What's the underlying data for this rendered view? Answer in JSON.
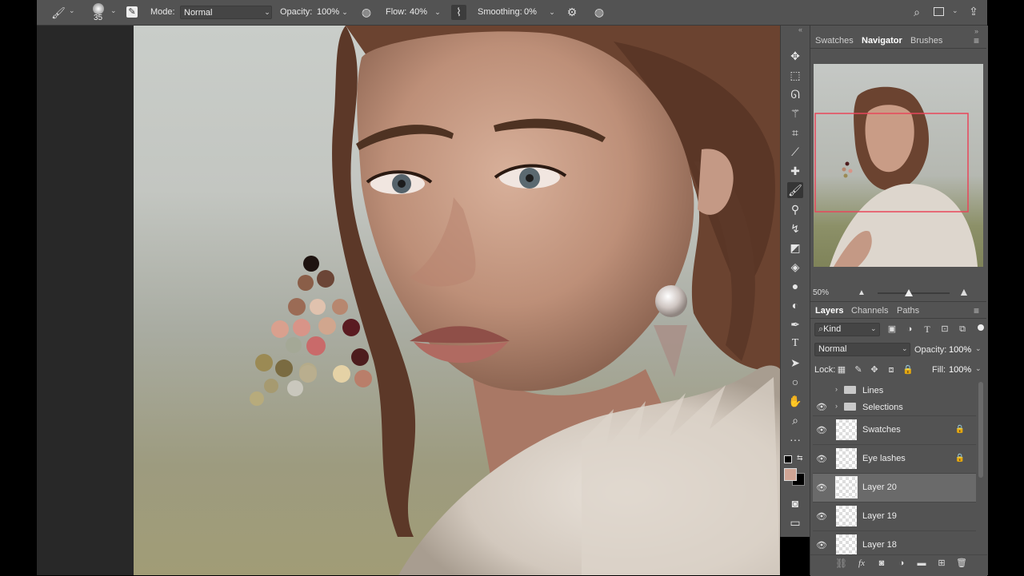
{
  "options_bar": {
    "brush_size": "35",
    "mode_label": "Mode:",
    "mode_value": "Normal",
    "opacity_label": "Opacity:",
    "opacity_value": "100%",
    "flow_label": "Flow:",
    "flow_value": "40%",
    "smoothing_label": "Smoothing:",
    "smoothing_value": "0%"
  },
  "navigator_panel": {
    "tabs": [
      "Swatches",
      "Navigator",
      "Brushes"
    ],
    "active_tab": "Navigator",
    "zoom": "50%"
  },
  "layers_panel": {
    "tabs": [
      "Layers",
      "Channels",
      "Paths"
    ],
    "active_tab": "Layers",
    "filter_kind": "Kind",
    "blend_mode": "Normal",
    "opacity_label": "Opacity:",
    "opacity_value": "100%",
    "lock_label": "Lock:",
    "fill_label": "Fill:",
    "fill_value": "100%",
    "groups": [
      {
        "name": "Lines",
        "visible": false
      },
      {
        "name": "Selections",
        "visible": true
      }
    ],
    "layers": [
      {
        "name": "Swatches",
        "locked": true,
        "selected": false
      },
      {
        "name": "Eye lashes",
        "locked": true,
        "selected": false
      },
      {
        "name": "Layer 20",
        "locked": false,
        "selected": true
      },
      {
        "name": "Layer 19",
        "locked": false,
        "selected": false
      },
      {
        "name": "Layer 18",
        "locked": false,
        "selected": false
      }
    ]
  },
  "colors": {
    "foreground": "#d0a595",
    "background": "#000000",
    "ui_panel": "#535353",
    "selection_highlight": "#6a6a6a",
    "navigator_frame": "#e8465a"
  },
  "icons": {
    "toolbar": [
      "move-icon",
      "marquee-icon",
      "lasso-icon",
      "magic-wand-icon",
      "crop-icon",
      "eyedropper-icon",
      "healing-brush-icon",
      "brush-icon",
      "clone-stamp-icon",
      "history-brush-icon",
      "eraser-icon",
      "paint-bucket-icon",
      "blur-icon",
      "dodge-icon",
      "pen-icon",
      "type-icon",
      "path-selection-icon",
      "ellipse-icon",
      "hand-icon",
      "zoom-icon",
      "more-tools-icon",
      "quick-mask-icon",
      "screen-mode-icon"
    ]
  }
}
